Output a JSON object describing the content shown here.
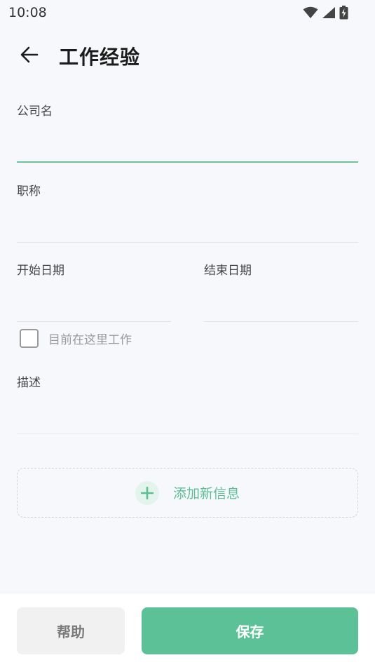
{
  "status_bar": {
    "time": "10:08"
  },
  "header": {
    "title": "工作经验"
  },
  "form": {
    "company": {
      "label": "公司名",
      "value": ""
    },
    "job_title": {
      "label": "职称",
      "value": ""
    },
    "start_date": {
      "label": "开始日期",
      "value": ""
    },
    "end_date": {
      "label": "结束日期",
      "value": ""
    },
    "current_job": {
      "label": "目前在这里工作",
      "checked": false
    },
    "description": {
      "label": "描述",
      "value": ""
    }
  },
  "add_new": {
    "label": "添加新信息"
  },
  "footer": {
    "help_label": "帮助",
    "save_label": "保存"
  },
  "colors": {
    "accent": "#5cc197",
    "background": "#f7f8fc",
    "help_button": "#f1f1f1"
  },
  "icons": {
    "back": "arrow-left-icon",
    "add": "plus-icon",
    "wifi": "wifi-icon",
    "signal": "signal-icon",
    "battery": "battery-charging-icon"
  }
}
